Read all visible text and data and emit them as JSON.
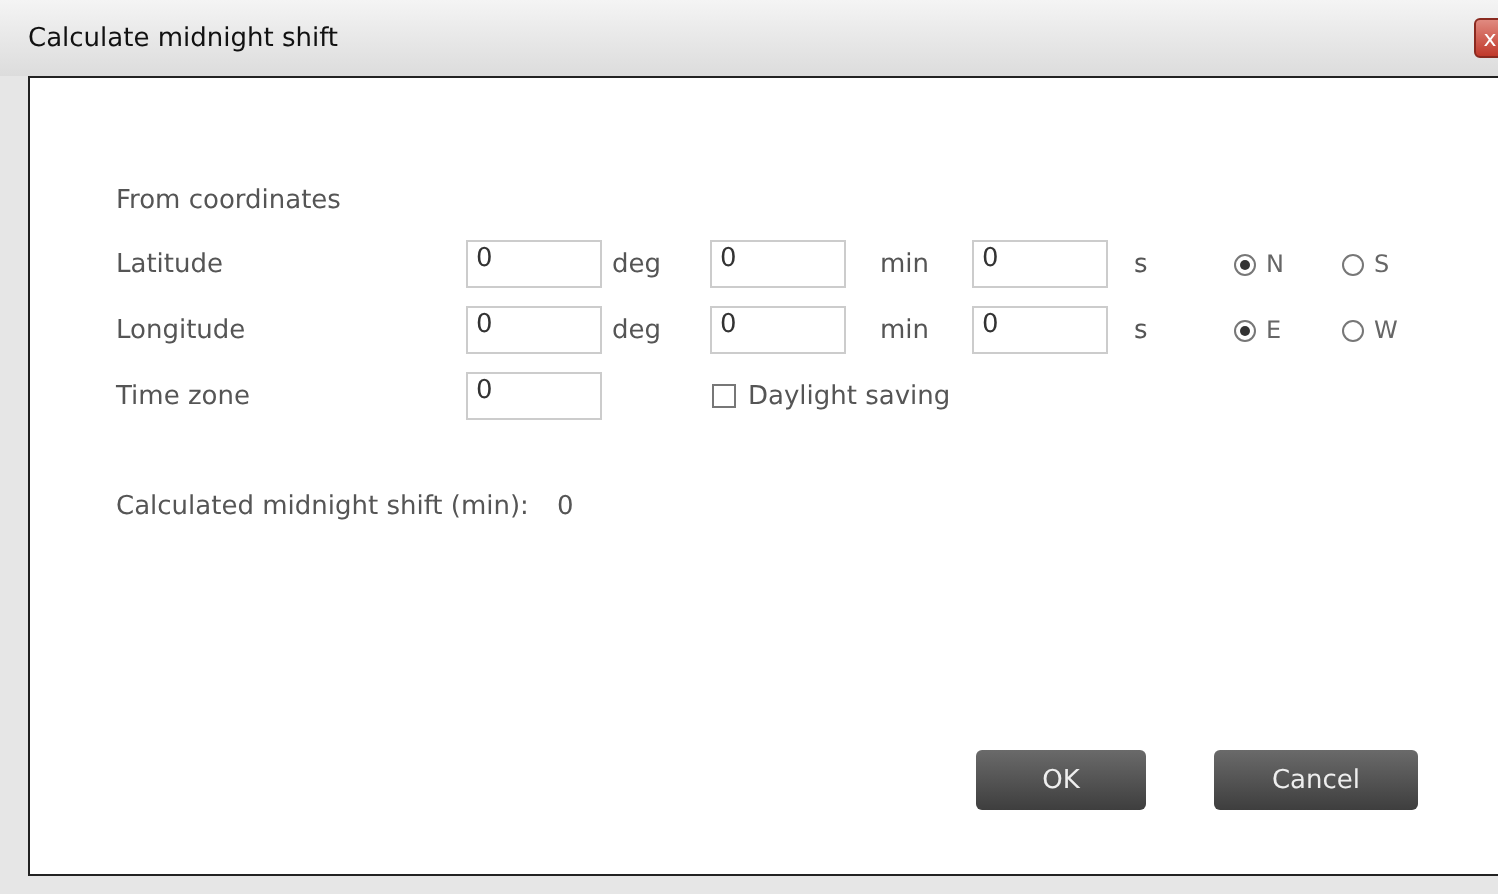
{
  "window": {
    "title": "Calculate midnight shift",
    "close": "x"
  },
  "section_label": "From coordinates",
  "coordinates": [
    {
      "label": "Latitude",
      "deg": "0",
      "deg_unit": "deg",
      "min": "0",
      "min_unit": "min",
      "sec": "0",
      "sec_unit": "s",
      "options": [
        {
          "label": "N",
          "selected": true
        },
        {
          "label": "S",
          "selected": false
        }
      ]
    },
    {
      "label": "Longitude",
      "deg": "0",
      "deg_unit": "deg",
      "min": "0",
      "min_unit": "min",
      "sec": "0",
      "sec_unit": "s",
      "options": [
        {
          "label": "E",
          "selected": true
        },
        {
          "label": "W",
          "selected": false
        }
      ]
    }
  ],
  "time_zone": {
    "label": "Time zone",
    "value": "0"
  },
  "daylight_saving": {
    "label": "Daylight saving",
    "checked": false
  },
  "result": {
    "label": "Calculated midnight shift (min):",
    "value": "0"
  },
  "buttons": [
    "OK",
    "Cancel"
  ]
}
